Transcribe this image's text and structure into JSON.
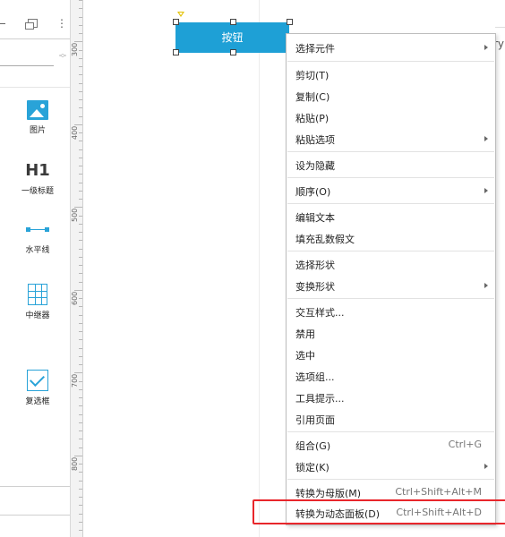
{
  "colors": {
    "accent": "#1ea0d6",
    "highlight_border": "#e8262b",
    "selection_marker": "#e3c200"
  },
  "left_panel": {
    "toolbar_icons": [
      "minus-icon",
      "window-icon",
      "more-icon"
    ],
    "library_items": [
      {
        "label": "图片",
        "icon": "image-icon"
      },
      {
        "label": "一级标题",
        "icon": "h1-icon",
        "icon_text": "H1"
      },
      {
        "label": "水平线",
        "icon": "horizontal-line-icon"
      },
      {
        "label": "中继器",
        "icon": "repeater-icon"
      },
      {
        "label": "复选框",
        "icon": "checkbox-icon"
      }
    ]
  },
  "ruler": {
    "labels": [
      "300",
      "400",
      "500",
      "600",
      "700",
      "800"
    ]
  },
  "canvas": {
    "button_widget_label": "按钮",
    "right_fragment_text": "ry"
  },
  "context_menu": {
    "items": [
      {
        "label": "选择元件",
        "submenu": true
      },
      {
        "label": "剪切(T)"
      },
      {
        "label": "复制(C)"
      },
      {
        "label": "粘贴(P)"
      },
      {
        "label": "粘贴选项",
        "submenu": true
      },
      {
        "label": "设为隐藏"
      },
      {
        "label": "顺序(O)",
        "submenu": true
      },
      {
        "label": "编辑文本"
      },
      {
        "label": "填充乱数假文"
      },
      {
        "label": "选择形状"
      },
      {
        "label": "变换形状",
        "submenu": true
      },
      {
        "label": "交互样式..."
      },
      {
        "label": "禁用"
      },
      {
        "label": "选中"
      },
      {
        "label": "选项组..."
      },
      {
        "label": "工具提示..."
      },
      {
        "label": "引用页面"
      },
      {
        "label": "组合(G)",
        "shortcut": "Ctrl+G"
      },
      {
        "label": "锁定(K)",
        "submenu": true
      },
      {
        "label": "转换为母版(M)",
        "shortcut": "Ctrl+Shift+Alt+M"
      },
      {
        "label": "转换为动态面板(D)",
        "shortcut": "Ctrl+Shift+Alt+D",
        "highlighted": true
      }
    ]
  }
}
